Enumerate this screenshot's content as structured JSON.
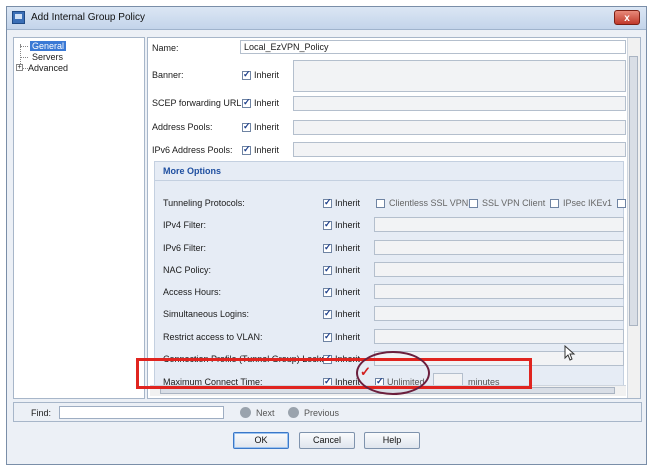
{
  "window": {
    "title": "Add Internal Group Policy",
    "close_label": "x"
  },
  "tree": {
    "items": [
      {
        "label": "General",
        "selected": true
      },
      {
        "label": "Servers"
      },
      {
        "label": "Advanced",
        "expander": "+"
      }
    ]
  },
  "top_fields": [
    {
      "label": "Name:",
      "value": "Local_EzVPN_Policy"
    },
    {
      "label": "Banner:",
      "inherit": "Inherit"
    },
    {
      "label": "SCEP forwarding URL:",
      "inherit": "Inherit"
    },
    {
      "label": "Address Pools:",
      "inherit": "Inherit"
    },
    {
      "label": "IPv6 Address Pools:",
      "inherit": "Inherit"
    }
  ],
  "more_options": {
    "title": "More Options",
    "rows": [
      {
        "label": "Tunneling Protocols:",
        "inherit": "Inherit"
      },
      {
        "label": "IPv4 Filter:",
        "inherit": "Inherit"
      },
      {
        "label": "IPv6 Filter:",
        "inherit": "Inherit"
      },
      {
        "label": "NAC Policy:",
        "inherit": "Inherit"
      },
      {
        "label": "Access Hours:",
        "inherit": "Inherit"
      },
      {
        "label": "Simultaneous Logins:",
        "inherit": "Inherit"
      },
      {
        "label": "Restrict access to VLAN:",
        "inherit": "Inherit"
      },
      {
        "label": "Connection Profile (Tunnel Group) Lock:",
        "inherit": "Inherit"
      },
      {
        "label": "Maximum Connect Time:",
        "inherit": "Inherit"
      }
    ],
    "protocols": [
      "Clientless SSL VPN",
      "SSL VPN Client",
      "IPsec IKEv1"
    ],
    "unlimited_label": "Unlimited",
    "minutes_label": "minutes"
  },
  "find": {
    "label": "Find:",
    "next": "Next",
    "previous": "Previous"
  },
  "buttons": {
    "ok": "OK",
    "cancel": "Cancel",
    "help": "Help"
  },
  "colors": {
    "highlight_box": "#e0241f",
    "ellipse": "#6b1f3d",
    "selection": "#3a79d5"
  }
}
